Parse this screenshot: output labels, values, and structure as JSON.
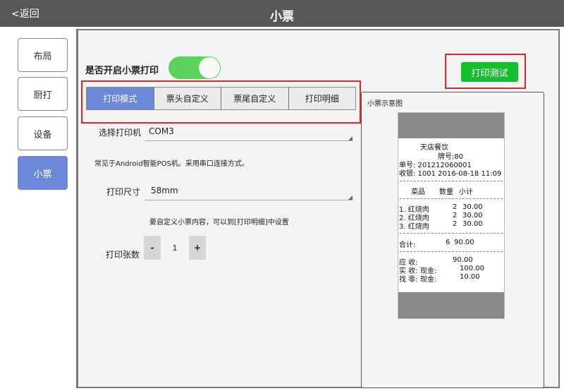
{
  "topbar": {
    "back_label": "<返回",
    "title": "小票"
  },
  "sidebar": {
    "items": [
      {
        "label": "布局"
      },
      {
        "label": "厨打"
      },
      {
        "label": "设备"
      },
      {
        "label": "小票"
      }
    ],
    "active_index": 3
  },
  "print_toggle": {
    "label": "是否开启小票打印",
    "on": true
  },
  "test_button": {
    "label": "打印测试"
  },
  "tabs": [
    {
      "label": "打印模式"
    },
    {
      "label": "票头自定义"
    },
    {
      "label": "票尾自定义"
    },
    {
      "label": "打印明细"
    }
  ],
  "printer": {
    "label": "选择打印机",
    "value": "COM3",
    "hint": "常见于Android智能POS机。采用串口连接方式。"
  },
  "paper_size": {
    "label": "打印尺寸",
    "value": "58mm",
    "hint": "要自定义小票内容，可以到[打印明细]中设置"
  },
  "copies": {
    "label": "打印张数",
    "minus": "-",
    "value": "1",
    "plus": "+"
  },
  "preview": {
    "title": "小票示意图",
    "shop": "天店餐饮",
    "plate": "牌号:80",
    "order_no": "单号: 201212060001",
    "cashier": "收银: 1001 2016-08-18 11:09",
    "header": {
      "dish": "菜品",
      "qty": "数量",
      "subtotal": "小计"
    },
    "items": [
      {
        "name": "1. 红烧肉",
        "qty": "2",
        "price": "30.00"
      },
      {
        "name": "2. 红烧肉",
        "qty": "2",
        "price": "30.00"
      },
      {
        "name": "3. 红烧肉",
        "qty": "2",
        "price": "30.00"
      }
    ],
    "total": {
      "label": "合计:",
      "qty": "6",
      "amount": "90.00"
    },
    "due": {
      "label": "应 收:",
      "amount": "90.00"
    },
    "paid": {
      "label": "实 收:",
      "method": "现金:",
      "amount": "100.00"
    },
    "change": {
      "label": "找 零:",
      "method": "现金:",
      "amount": "10.00"
    }
  },
  "colors": {
    "accent": "#6c88d8",
    "toggle_on": "#5bd35c",
    "test_button": "#14be2d",
    "highlight": "#e32626",
    "topbar": "#575757"
  }
}
